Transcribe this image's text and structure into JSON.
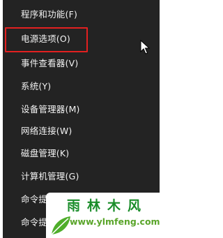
{
  "menu": {
    "items": [
      {
        "label": "程序和功能(F)"
      },
      {
        "label": "电源选项(O)"
      },
      {
        "label": "事件查看器(V)"
      },
      {
        "label": "系统(Y)"
      },
      {
        "label": "设备管理器(M)"
      },
      {
        "label": "网络连接(W)"
      },
      {
        "label": "磁盘管理(K)"
      },
      {
        "label": "计算机管理(G)"
      },
      {
        "label": "命令提示符(C)"
      },
      {
        "label": "命令提示符(管理员)(A)"
      }
    ],
    "highlighted_item": "电源选项(O)"
  },
  "watermark": {
    "title": "雨林木风",
    "url": "www.ylmfeng.com"
  },
  "colors": {
    "menu_background": "#232323",
    "menu_text": "#f2f2f2",
    "highlight_border": "#e32020",
    "watermark_green": "#1a8d2a"
  }
}
